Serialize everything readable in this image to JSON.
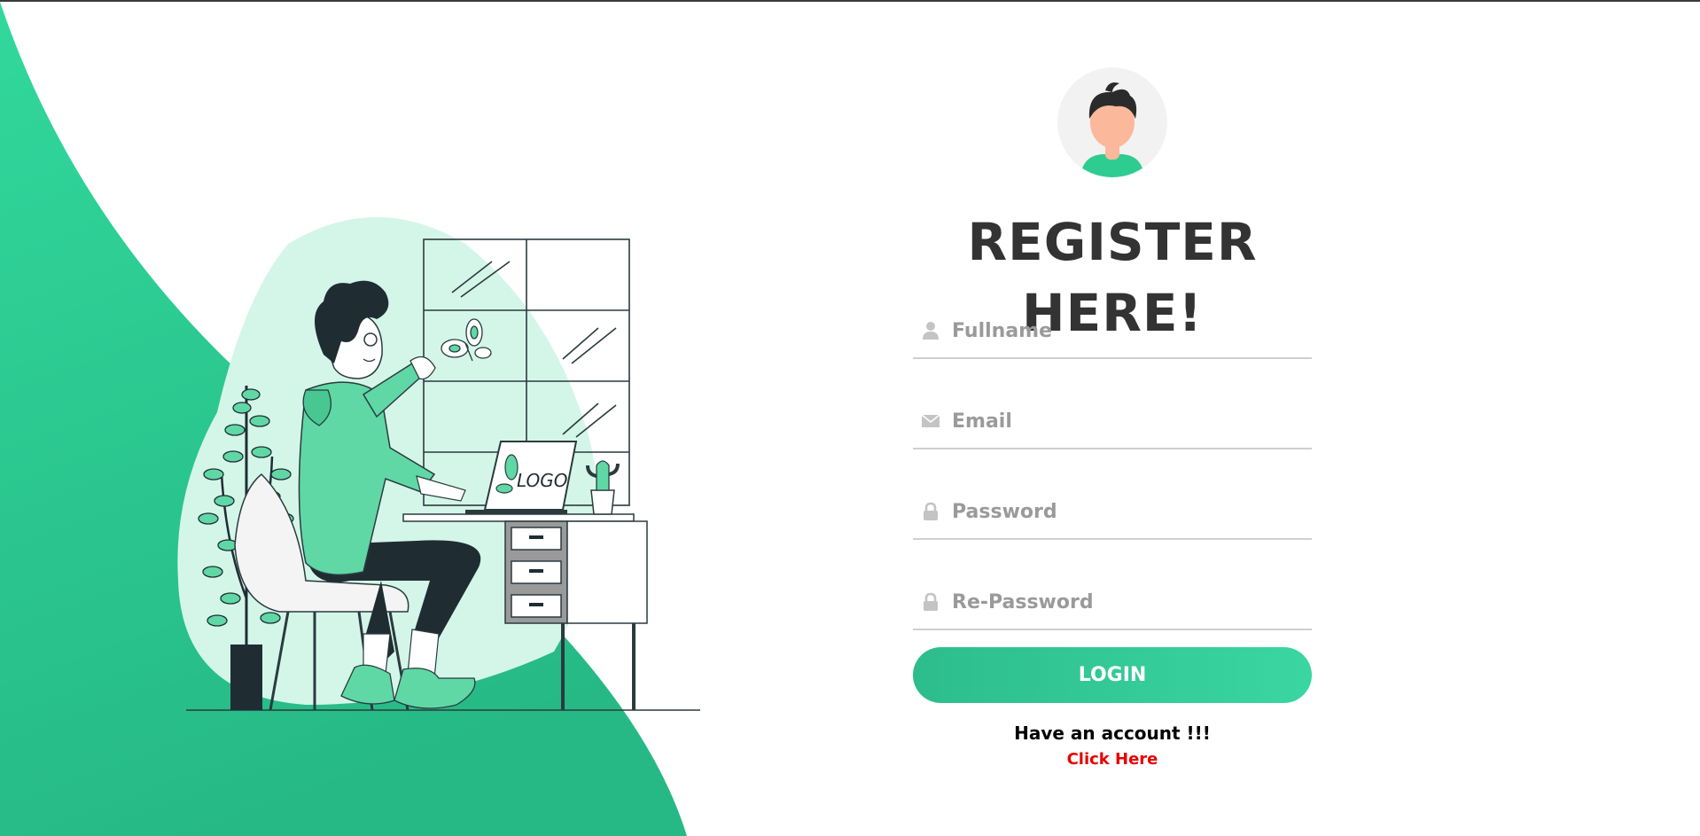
{
  "colors": {
    "accent": "#2ecc91",
    "accent_light": "#d4f6e8",
    "dark": "#1f2d33",
    "link": "#e60000",
    "title": "#333333"
  },
  "avatar": {
    "icon": "user-avatar-icon"
  },
  "illustration": {
    "icon": "person-at-desk-illustration",
    "laptop_logo_text": "LOGO"
  },
  "form": {
    "title": "REGISTER HERE!",
    "fields": [
      {
        "name": "fullname",
        "placeholder": "Fullname",
        "value": "",
        "icon": "user-icon"
      },
      {
        "name": "email",
        "placeholder": "Email",
        "value": "",
        "icon": "envelope-icon"
      },
      {
        "name": "password",
        "placeholder": "Password",
        "value": "",
        "icon": "lock-icon"
      },
      {
        "name": "re-password",
        "placeholder": "Re-Password",
        "value": "",
        "icon": "lock-icon"
      }
    ],
    "login_label": "LOGIN",
    "account_text": "Have an account !!!",
    "link_text": "Click Here"
  }
}
